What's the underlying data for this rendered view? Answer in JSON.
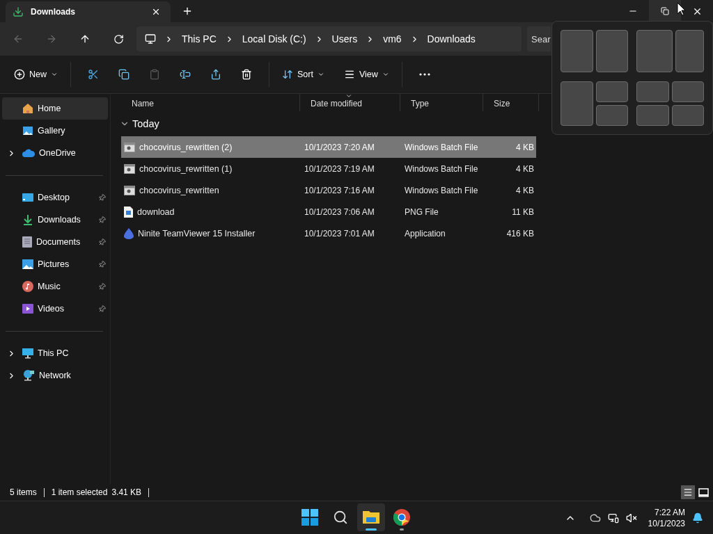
{
  "window": {
    "tab": {
      "title": "Downloads"
    }
  },
  "address": {
    "crumbs": [
      "This PC",
      "Local Disk (C:)",
      "Users",
      "vm6",
      "Downloads"
    ],
    "search": {
      "placeholder": "Sear"
    }
  },
  "toolbar": {
    "new": {
      "label": "New"
    },
    "actions": [
      {
        "disabled": false
      },
      {
        "disabled": false
      },
      {
        "disabled": true
      },
      {
        "disabled": false
      },
      {
        "disabled": false
      },
      {
        "disabled": false
      }
    ],
    "sort": {
      "label": "Sort"
    },
    "view": {
      "label": "View"
    }
  },
  "sidebar": {
    "groups": [
      {
        "items": [
          {
            "label": "Home",
            "selected": true,
            "pinned": false
          },
          {
            "label": "Gallery",
            "selected": false,
            "pinned": false
          },
          {
            "label": "OneDrive",
            "selected": false,
            "pinned": false,
            "expanded": false
          }
        ]
      },
      {
        "items": [
          {
            "label": "Desktop",
            "selected": false,
            "pinned": true
          },
          {
            "label": "Downloads",
            "selected": false,
            "pinned": true
          },
          {
            "label": "Documents",
            "selected": false,
            "pinned": true
          },
          {
            "label": "Pictures",
            "selected": false,
            "pinned": true
          },
          {
            "label": "Music",
            "selected": false,
            "pinned": true
          },
          {
            "label": "Videos",
            "selected": false,
            "pinned": true
          }
        ]
      },
      {
        "items": [
          {
            "label": "This PC",
            "selected": false,
            "pinned": false,
            "expanded": false
          },
          {
            "label": "Network",
            "selected": false,
            "pinned": false,
            "expanded": false
          }
        ]
      }
    ]
  },
  "table": {
    "columns": [
      {
        "label": "Name",
        "sorted": false
      },
      {
        "label": "Date modified",
        "sorted": true
      },
      {
        "label": "Type",
        "sorted": false
      },
      {
        "label": "Size",
        "sorted": false
      }
    ],
    "groups": [
      {
        "label": "Today",
        "expanded": true,
        "rows": [
          {
            "kind": "batch",
            "name": "chocovirus_rewritten (2)",
            "date": "10/1/2023 7:20 AM",
            "type": "Windows Batch File",
            "size": "4 KB",
            "selected": true
          },
          {
            "kind": "batch",
            "name": "chocovirus_rewritten (1)",
            "date": "10/1/2023 7:19 AM",
            "type": "Windows Batch File",
            "size": "4 KB",
            "selected": false
          },
          {
            "kind": "batch",
            "name": "chocovirus_rewritten",
            "date": "10/1/2023 7:16 AM",
            "type": "Windows Batch File",
            "size": "4 KB",
            "selected": false
          },
          {
            "kind": "image",
            "name": "download",
            "date": "10/1/2023 7:06 AM",
            "type": "PNG File",
            "size": "11 KB",
            "selected": false
          },
          {
            "kind": "app",
            "name": "Ninite TeamViewer 15 Installer",
            "date": "10/1/2023 7:01 AM",
            "type": "Application",
            "size": "416 KB",
            "selected": false
          }
        ]
      }
    ]
  },
  "status_bar": {
    "count": "5 items",
    "selection": "1 item selected",
    "size": "3.41 KB",
    "views": [
      {
        "selected": true
      },
      {
        "selected": false
      }
    ]
  },
  "taskbar": {
    "apps": [
      {
        "active": true
      },
      {
        "active": false
      }
    ],
    "clock": {
      "time": "7:22 AM",
      "date": "10/1/2023"
    }
  }
}
